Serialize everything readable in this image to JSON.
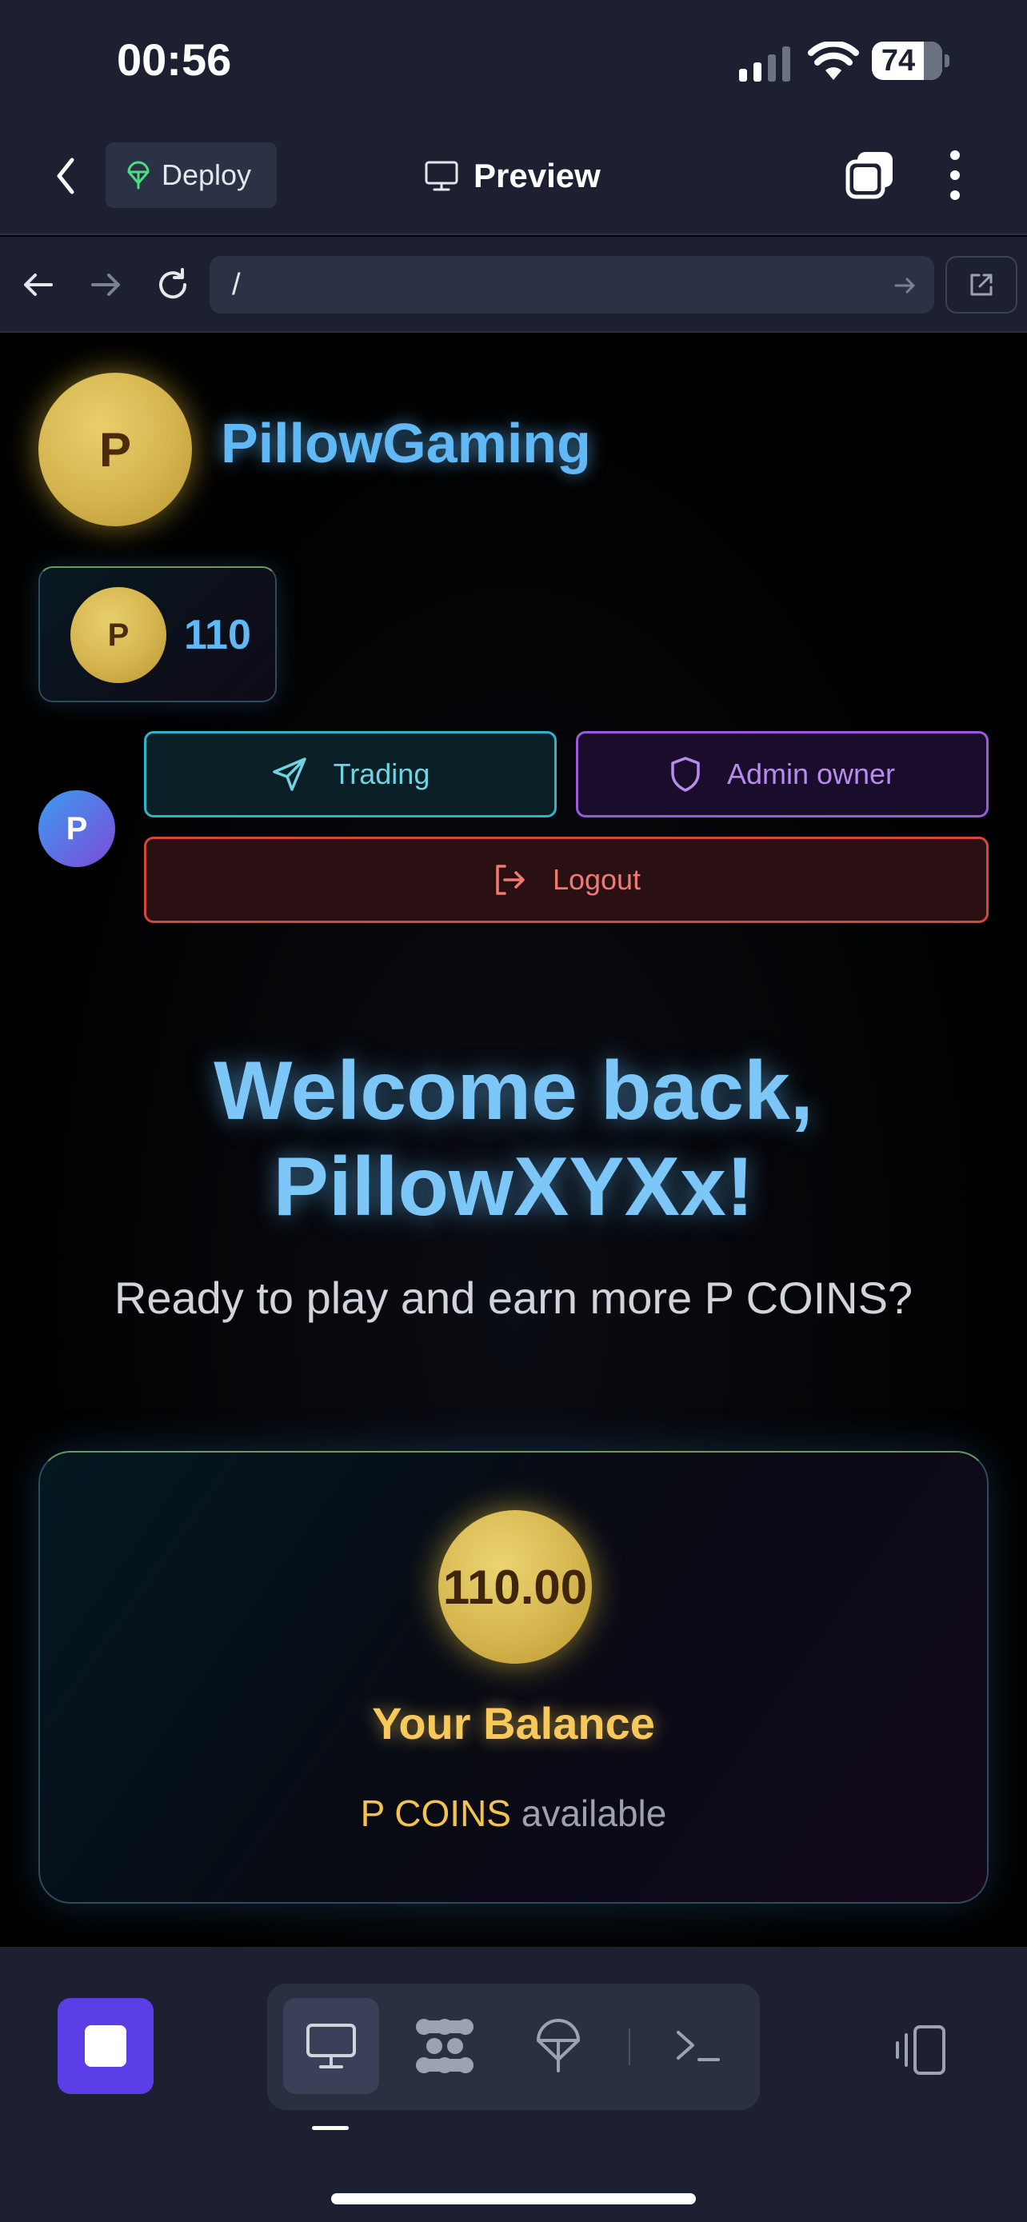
{
  "status_bar": {
    "time": "00:56",
    "battery_level": "74",
    "battery_fraction": 0.74
  },
  "app_header": {
    "back_icon": "chevron-left-icon",
    "deploy_label": "Deploy",
    "deploy_icon": "deploy-parachute-icon",
    "preview_label": "Preview",
    "preview_icon": "monitor-icon",
    "tabs_icon": "tabs-stack-icon",
    "more_icon": "more-vertical-icon"
  },
  "browser_bar": {
    "url": "/",
    "back_icon": "arrow-left-icon",
    "forward_icon": "arrow-right-icon",
    "reload_icon": "refresh-icon",
    "open_external_icon": "external-link-icon"
  },
  "page": {
    "logo_letter": "P",
    "brand_name": "PillowGaming",
    "coin_badge": {
      "letter": "P",
      "value": "110"
    },
    "avatar_letter": "P",
    "buttons": {
      "trading": "Trading",
      "admin": "Admin owner",
      "logout": "Logout"
    },
    "welcome_line1": "Welcome back,",
    "welcome_line2": "PillowXYXx!",
    "subtitle": "Ready to play and earn more P COINS?",
    "balance": {
      "amount": "110.00",
      "title": "Your Balance",
      "unit": "P COINS",
      "unit_suffix": " available"
    }
  },
  "toolbar": {
    "stop_icon": "stop-icon",
    "tools": [
      "monitor-icon",
      "grid-blobs-icon",
      "deploy-parachute-icon",
      "terminal-icon"
    ],
    "active_tool": "monitor-icon",
    "device_icon": "device-rotate-icon"
  },
  "colors": {
    "brand_blue": "#60b8f5",
    "coin_gold": "#d4b44f",
    "trading_teal": "#2fb3c6",
    "admin_purple": "#9b59e0",
    "logout_red": "#d5473f",
    "stop_purple": "#5b3ee6"
  }
}
